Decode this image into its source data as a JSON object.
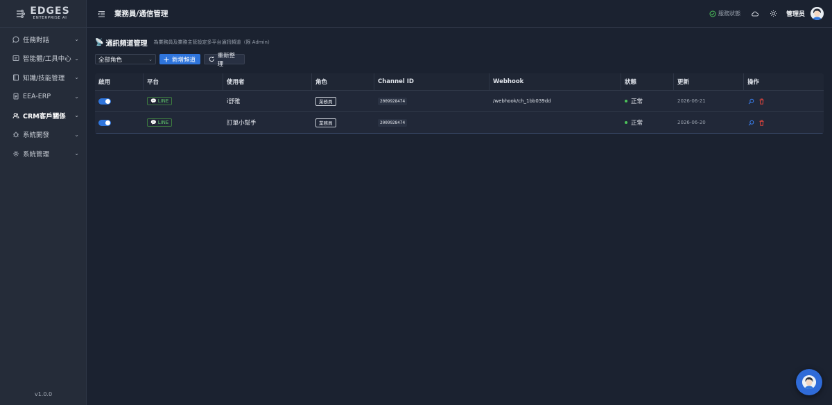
{
  "brand": {
    "logo_main": "EDGES",
    "logo_sub": "ENTERPRISE AI"
  },
  "sidebar": {
    "items": [
      {
        "label": "任務對話",
        "icon": "chat-bubble-icon"
      },
      {
        "label": "智能體/工具中心",
        "icon": "monitor-icon"
      },
      {
        "label": "知識/技能管理",
        "icon": "book-icon"
      },
      {
        "label": "EEA-ERP",
        "icon": "document-icon"
      },
      {
        "label": "CRM客戶關係",
        "icon": "users-icon"
      },
      {
        "label": "系統開發",
        "icon": "bug-icon"
      },
      {
        "label": "系統管理",
        "icon": "gear-icon"
      }
    ],
    "version": "v1.0.0"
  },
  "header": {
    "title": "業務員/通信管理",
    "status": "服務狀態",
    "admin": "管理员"
  },
  "section": {
    "icon": "📡",
    "title": "通訊頻道管理",
    "desc": "為業務員及業務主管設定多平台通訊頻道（限 Admin）"
  },
  "toolbar": {
    "select_value": "全部角色",
    "add_label": "新增頻道",
    "refresh_label": "重新整理"
  },
  "table": {
    "headers": [
      "啟用",
      "平台",
      "使用者",
      "角色",
      "Channel ID",
      "Webhook",
      "狀態",
      "更新",
      "操作"
    ],
    "rows": [
      {
        "platform": "LINE",
        "user": "i舒雅",
        "role": "業務員",
        "channel_id": "2009928474",
        "webhook": "/webhook/ch_1bb039dd",
        "status": "正常",
        "updated": "2026-06-21"
      },
      {
        "platform": "LINE",
        "user": "訂單小幫手",
        "role": "業務員",
        "channel_id": "2009928474",
        "webhook": "",
        "status": "正常",
        "updated": "2026-06-20"
      }
    ]
  },
  "colors": {
    "accent": "#2f75dc",
    "ok": "#4cc35a",
    "line_green": "#5ec26a",
    "danger": "#e0443c"
  }
}
